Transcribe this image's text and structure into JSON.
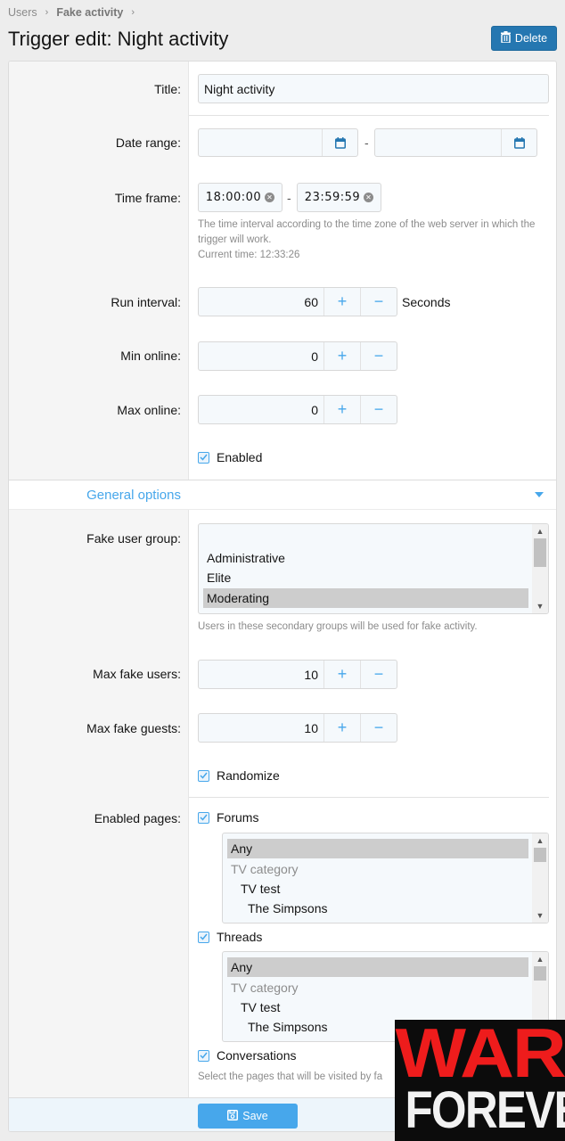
{
  "breadcrumb": [
    {
      "label": "Users"
    },
    {
      "label": "Fake activity"
    }
  ],
  "page": {
    "title": "Trigger edit: Night activity",
    "delete_label": "Delete"
  },
  "form": {
    "title": {
      "label": "Title:",
      "value": "Night activity"
    },
    "date_range": {
      "label": "Date range:",
      "start": "",
      "end": "",
      "separator": "-"
    },
    "time_frame": {
      "label": "Time frame:",
      "start": "18:00:00",
      "end": "23:59:59",
      "separator": "-",
      "hint": "The time interval according to the time zone of the web server in which the trigger will work.",
      "current_time": "Current time: 12:33:26"
    },
    "run_interval": {
      "label": "Run interval:",
      "value": "60",
      "unit": "Seconds"
    },
    "min_online": {
      "label": "Min online:",
      "value": "0"
    },
    "max_online": {
      "label": "Max online:",
      "value": "0"
    },
    "enabled": {
      "label": "Enabled",
      "checked": true
    }
  },
  "general_options": {
    "title": "General options",
    "fake_user_group": {
      "label": "Fake user group:",
      "options": [
        {
          "label": "",
          "selected": false
        },
        {
          "label": "Administrative",
          "selected": false
        },
        {
          "label": "Elite",
          "selected": false
        },
        {
          "label": "Moderating",
          "selected": true
        }
      ],
      "hint": "Users in these secondary groups will be used for fake activity."
    },
    "max_fake_users": {
      "label": "Max fake users:",
      "value": "10"
    },
    "max_fake_guests": {
      "label": "Max fake guests:",
      "value": "10"
    },
    "randomize": {
      "label": "Randomize",
      "checked": true
    },
    "enabled_pages": {
      "label": "Enabled pages:",
      "forums": {
        "label": "Forums",
        "checked": true,
        "options": [
          {
            "label": "Any",
            "selected": true
          },
          {
            "label": "TV category",
            "muted": true
          },
          {
            "label": "TV test"
          },
          {
            "label": "The Simpsons"
          }
        ]
      },
      "threads": {
        "label": "Threads",
        "checked": true,
        "options": [
          {
            "label": "Any",
            "selected": true
          },
          {
            "label": "TV category",
            "muted": true
          },
          {
            "label": "TV test"
          },
          {
            "label": "The Simpsons"
          }
        ]
      },
      "conversations": {
        "label": "Conversations",
        "checked": true
      },
      "hint": "Select the pages that will be visited by fa"
    }
  },
  "footer": {
    "save_label": "Save"
  },
  "overlay": {
    "line1": "WAR",
    "line2": "FOREVER"
  },
  "colors": {
    "accent": "#47a7eb",
    "delete": "#2577b1",
    "watermark_red": "#ee1c1c"
  }
}
